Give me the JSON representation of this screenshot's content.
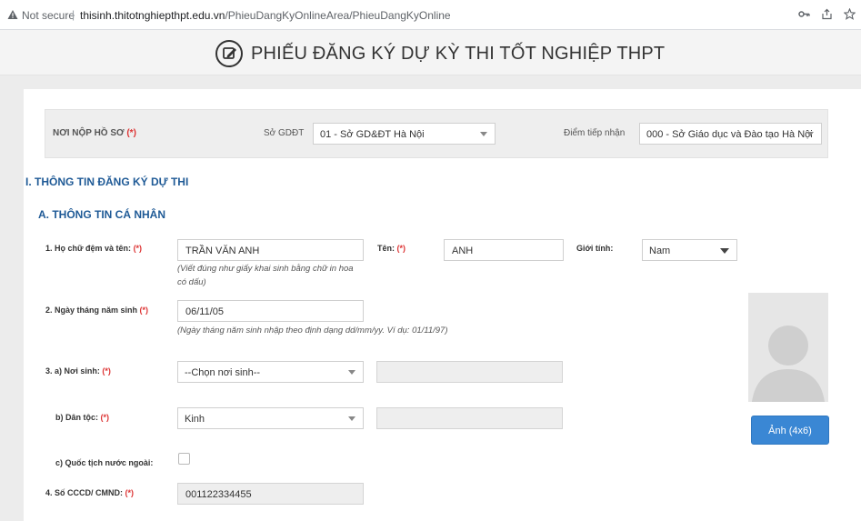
{
  "browser": {
    "not_secure": "Not secure",
    "separator": "|",
    "url_host": "thisinh.thitotnghiepthpt.edu.vn",
    "url_path": "/PhieuDangKyOnlineArea/PhieuDangKyOnline"
  },
  "header": {
    "title": "PHIẾU ĐĂNG KÝ DỰ KỲ THI TỐT NGHIỆP THPT"
  },
  "submission": {
    "label": "NƠI NỘP HỒ SƠ",
    "required_mark": "(*)",
    "so_gddt_label": "Sở GDĐT",
    "so_gddt_value": "01 - Sở GD&ĐT Hà Nội",
    "diem_label": "Điểm tiếp nhận",
    "diem_value": "000 - Sở Giáo dục và Đào tạo Hà Nội"
  },
  "sections": {
    "section1": "I. THÔNG TIN ĐĂNG KÝ DỰ THI",
    "sectionA": "A. THÔNG TIN CÁ NHÂN"
  },
  "form": {
    "req": "(*)",
    "fullname_label": "1. Họ chữ đệm và tên:",
    "fullname_value": "TRẦN VĂN ANH",
    "fullname_hint_1": "(Viết đúng như giấy khai sinh bằng chữ in hoa",
    "fullname_hint_2": "có dấu)",
    "ten_label": "Tên:",
    "ten_value": "ANH",
    "gender_label": "Giới tính:",
    "gender_value": "Nam",
    "dob_label": "2. Ngày tháng năm sinh",
    "dob_value": "06/11/05",
    "dob_hint": "(Ngày tháng năm sinh nhập theo định dạng dd/mm/yy. Ví dụ: 01/11/97)",
    "birthplace_label": "3. a) Nơi sinh:",
    "birthplace_value": "--Chọn nơi sinh--",
    "ethnic_label": "b) Dân tộc:",
    "ethnic_value": "Kinh",
    "foreign_label": "c) Quốc tịch nước ngoài:",
    "id_label": "4. Số CCCD/ CMND:",
    "id_value": "001122334455"
  },
  "photo": {
    "button_label": "Ảnh (4x6)"
  },
  "colors": {
    "section_heading": "#1f5a96",
    "required": "#d33333",
    "button": "#3a87d4"
  }
}
